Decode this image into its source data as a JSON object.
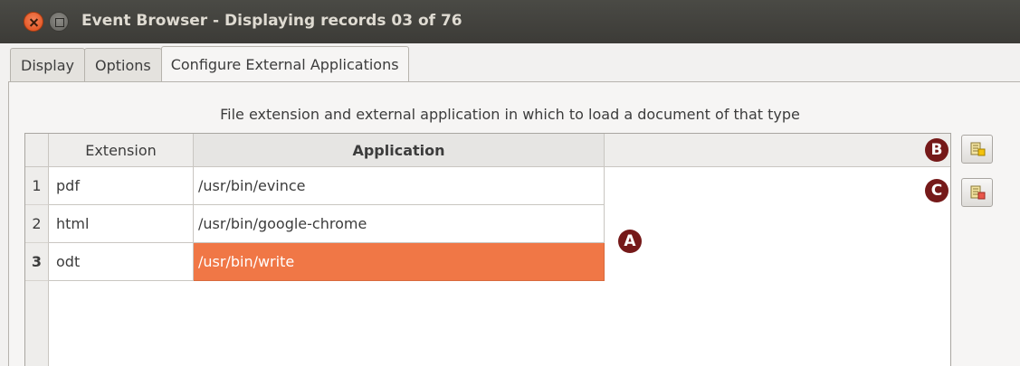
{
  "window": {
    "title": "Event Browser - Displaying records 03 of 76"
  },
  "tabs": [
    {
      "label": "Display"
    },
    {
      "label": "Options"
    },
    {
      "label": "Configure External Applications",
      "active": true
    }
  ],
  "panel": {
    "description": "File extension and external application in which to load a document of that type"
  },
  "table": {
    "columns": [
      "Extension",
      "Application"
    ],
    "rows": [
      {
        "num": "1",
        "extension": "pdf",
        "application": "/usr/bin/evince"
      },
      {
        "num": "2",
        "extension": "html",
        "application": "/usr/bin/google-chrome"
      },
      {
        "num": "3",
        "extension": "odt",
        "application": "/usr/bin/write",
        "selected": true
      }
    ]
  },
  "callouts": {
    "a": "A",
    "b": "B",
    "c": "C"
  },
  "buttons": {
    "add_icon": "add-row-icon",
    "remove_icon": "remove-row-icon"
  },
  "colors": {
    "selection": "#f07746",
    "callout": "#751919",
    "close_button": "#df4a16"
  }
}
